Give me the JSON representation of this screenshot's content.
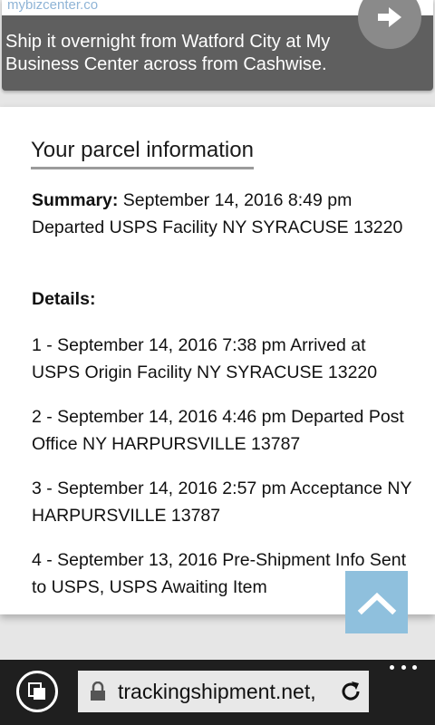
{
  "ad": {
    "domain": "mybizcenter.co",
    "text": "Ship it overnight from Watford City at My Business Center across from Cashwise."
  },
  "parcel": {
    "title": "Your parcel information",
    "summary_label": "Summary:",
    "summary_text": " September 14, 2016 8:49 pm Departed USPS Facility NY SYRACUSE 13220",
    "details_label": "Details:",
    "events": [
      "1 - September 14, 2016 7:38 pm Arrived at USPS Origin Facility NY SYRACUSE 13220",
      "2 - September 14, 2016 4:46 pm Departed Post Office NY HARPURSVILLE 13787",
      "3 - September 14, 2016 2:57 pm Acceptance NY HARPURSVILLE 13787",
      "4 - September 13, 2016 Pre-Shipment Info Sent to USPS, USPS Awaiting Item"
    ]
  },
  "browser": {
    "url": "trackingshipment.net,"
  },
  "icons": {
    "ad_arrow": "arrow-right-icon",
    "scroll_top": "chevron-up-icon",
    "tabs": "tabs-icon",
    "lock": "lock-icon",
    "refresh": "refresh-icon",
    "more": "more-icon"
  },
  "colors": {
    "ad_background": "#5f5f5f",
    "scroll_top_button": "#8fc0dd",
    "browser_bar": "#1f1f1f"
  }
}
